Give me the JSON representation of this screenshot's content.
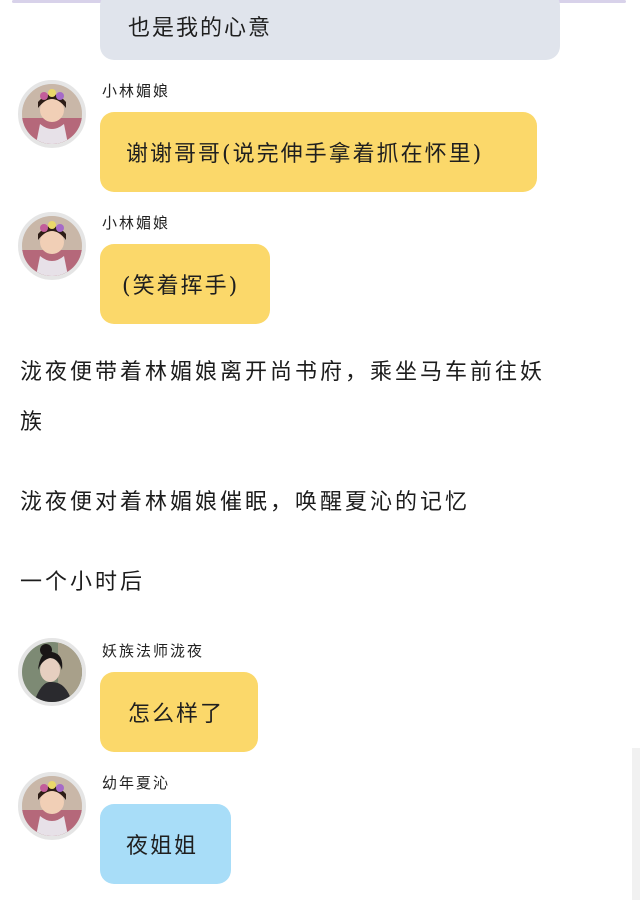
{
  "messages": [
    {
      "speaker": "",
      "text": "也是我的心意",
      "style": "gray"
    },
    {
      "speaker": "小林媚娘",
      "text": "谢谢哥哥(说完伸手拿着抓在怀里)",
      "style": "yellow",
      "avatar": "girl-avatar"
    },
    {
      "speaker": "小林媚娘",
      "text": "(笑着挥手)",
      "style": "yellow",
      "avatar": "girl-avatar"
    },
    {
      "speaker": "妖族法师泷夜",
      "text": "怎么样了",
      "style": "yellow",
      "avatar": "mage-avatar"
    },
    {
      "speaker": "幼年夏沁",
      "text": "夜姐姐",
      "style": "blue",
      "avatar": "girl-avatar"
    }
  ],
  "narration": [
    {
      "line1": "泷夜便带着林媚娘离开尚书府，乘坐马车前往妖",
      "line2": "族"
    },
    {
      "line1": "泷夜便对着林媚娘催眠，唤醒夏沁的记忆"
    },
    {
      "line1": "一个小时后"
    }
  ],
  "colors": {
    "bubble_gray": "#e0e4ec",
    "bubble_yellow": "#fbd86a",
    "bubble_blue": "#a8ddf8",
    "avatar_ring": "#e5e5e5"
  }
}
